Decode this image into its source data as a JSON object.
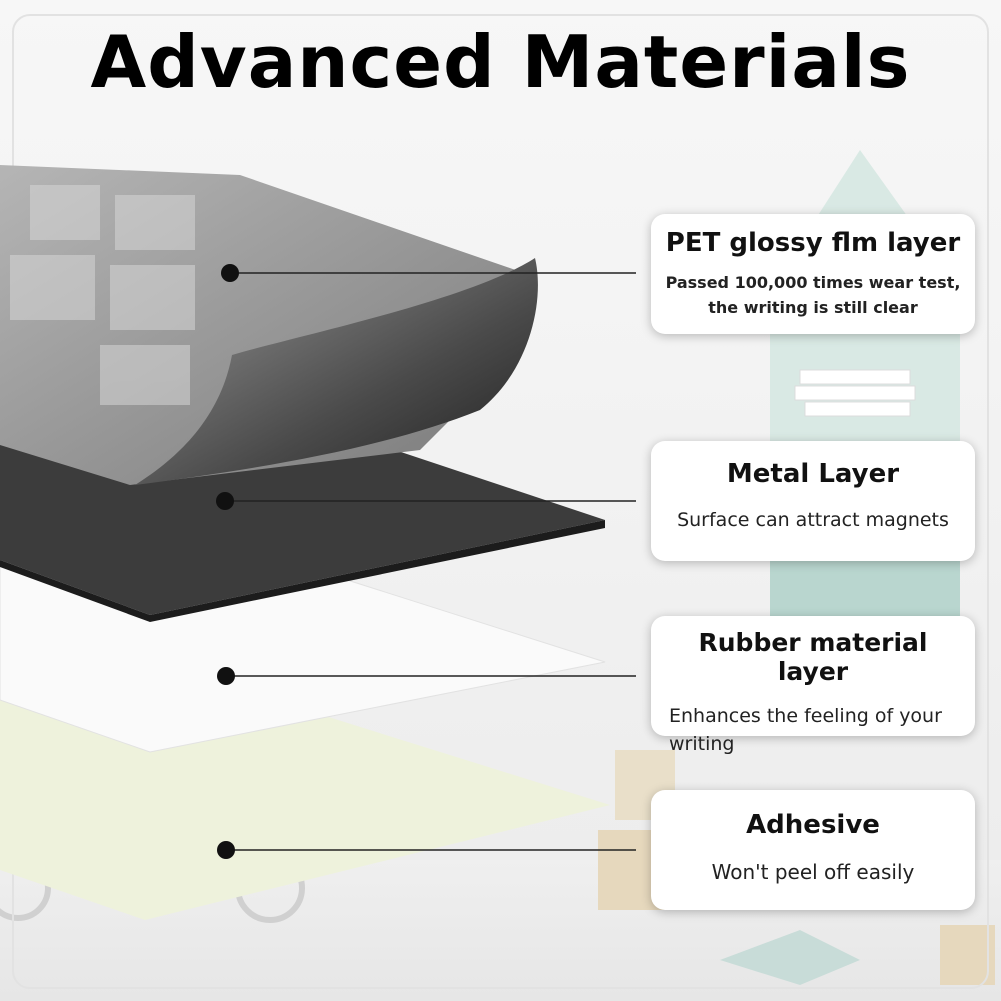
{
  "title": "Advanced Materials",
  "layers": [
    {
      "heading": "PET glossy flm layer",
      "description": "Passed 100,000 times wear test, the writing is still clear"
    },
    {
      "heading": "Metal Layer",
      "description": "Surface can attract magnets"
    },
    {
      "heading": "Rubber material layer",
      "description": "Enhances the feeling of your writing"
    },
    {
      "heading": "Adhesive",
      "description": "Won't peel off easily"
    }
  ],
  "colors": {
    "pet_layer": "#8f8f8f",
    "metal_layer": "#3c3c3c",
    "rubber_layer": "#fafafa",
    "adhesive_layer": "#eef2dc",
    "room_accent": "#b9d6cf"
  }
}
